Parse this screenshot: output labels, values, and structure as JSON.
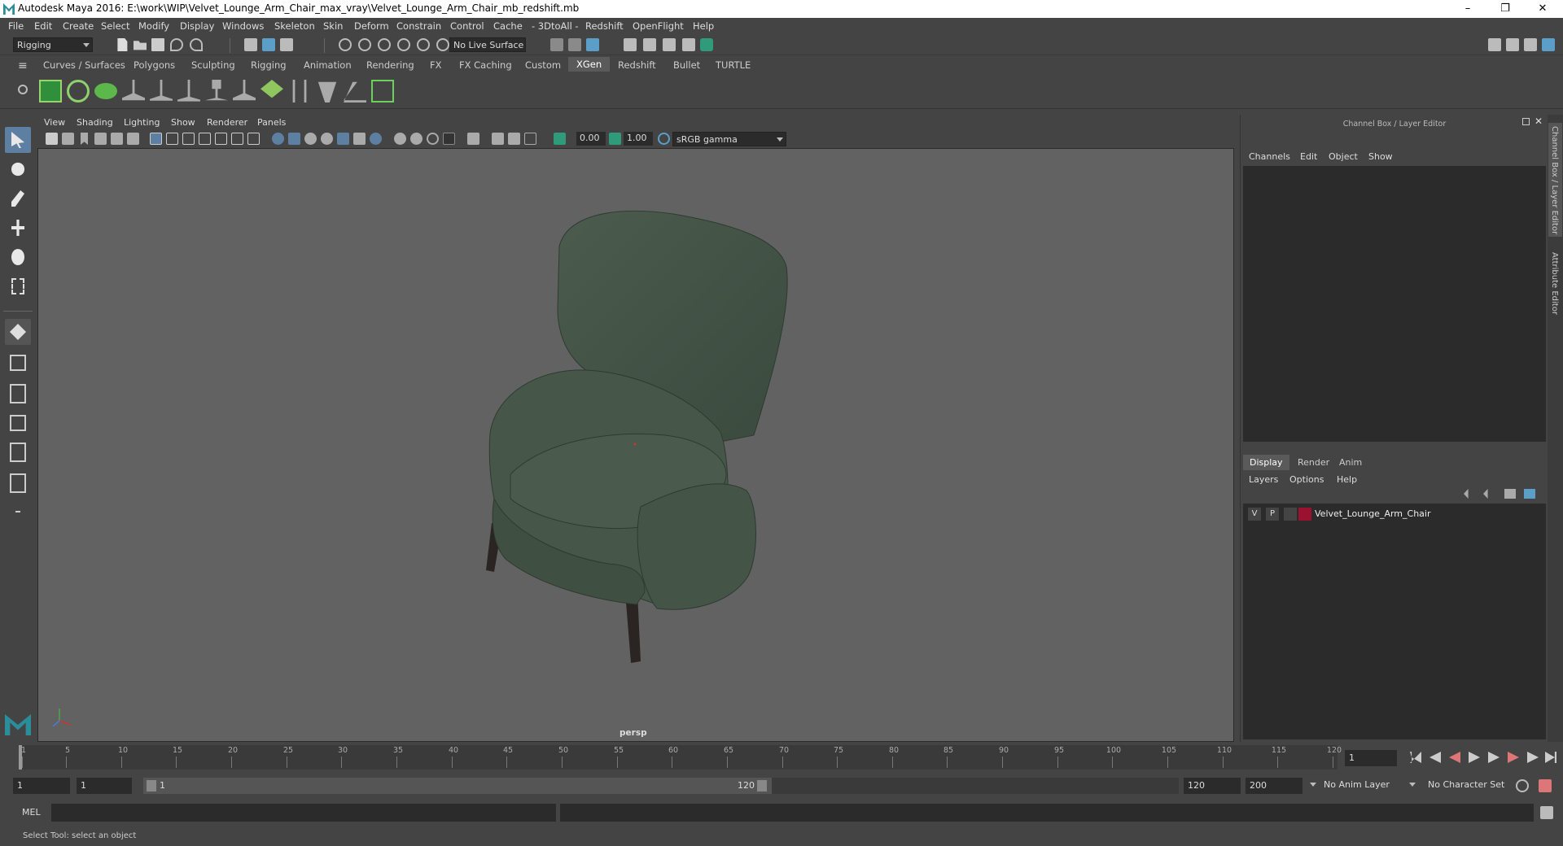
{
  "window": {
    "title": "Autodesk Maya 2016: E:\\work\\WIP\\Velvet_Lounge_Arm_Chair_max_vray\\Velvet_Lounge_Arm_Chair_mb_redshift.mb",
    "minimize": "–",
    "restore": "❐",
    "close": "✕"
  },
  "menubar": [
    "File",
    "Edit",
    "Create",
    "Select",
    "Modify",
    "Display",
    "Windows",
    "Skeleton",
    "Skin",
    "Deform",
    "Constrain",
    "Control",
    "Cache",
    "- 3DtoAll -",
    "Redshift",
    "OpenFlight",
    "Help"
  ],
  "statusline": {
    "menuset": "Rigging",
    "live_surface": "No Live Surface"
  },
  "shelf": {
    "tabs": [
      "Curves / Surfaces",
      "Polygons",
      "Sculpting",
      "Rigging",
      "Animation",
      "Rendering",
      "FX",
      "FX Caching",
      "Custom",
      "XGen",
      "Redshift",
      "Bullet",
      "TURTLE"
    ],
    "active_tab": "XGen"
  },
  "viewport": {
    "menus": [
      "View",
      "Shading",
      "Lighting",
      "Show",
      "Renderer",
      "Panels"
    ],
    "exposure": "0.00",
    "gamma": "1.00",
    "color_space": "sRGB gamma",
    "camera_label": "persp",
    "accent": "#5d7fa1"
  },
  "channel_box": {
    "title": "Channel Box / Layer Editor",
    "menus": [
      "Channels",
      "Edit",
      "Object",
      "Show"
    ],
    "layer_tabs": [
      "Display",
      "Render",
      "Anim"
    ],
    "active_layer_tab": "Display",
    "layer_menus": [
      "Layers",
      "Options",
      "Help"
    ],
    "layers": [
      {
        "v": "V",
        "p": "P",
        "color": "#9b1230",
        "name": "Velvet_Lounge_Arm_Chair"
      }
    ]
  },
  "side_tabs": [
    "Channel Box / Layer Editor",
    "Attribute Editor"
  ],
  "timeslider": {
    "tick_labels": [
      "1",
      "5",
      "10",
      "15",
      "20",
      "25",
      "30",
      "35",
      "40",
      "45",
      "50",
      "55",
      "60",
      "65",
      "70",
      "75",
      "80",
      "85",
      "90",
      "95",
      "100",
      "105",
      "110",
      "115",
      "120"
    ],
    "current_frame": "1"
  },
  "range": {
    "start": "1",
    "playback_start": "1",
    "range_start_label": "1",
    "range_end_label": "120",
    "playback_end": "120",
    "end": "200",
    "anim_layer": "No Anim Layer",
    "character_set": "No Character Set"
  },
  "cmdline": {
    "label": "MEL"
  },
  "helpline": {
    "text": "Select Tool: select an object"
  }
}
